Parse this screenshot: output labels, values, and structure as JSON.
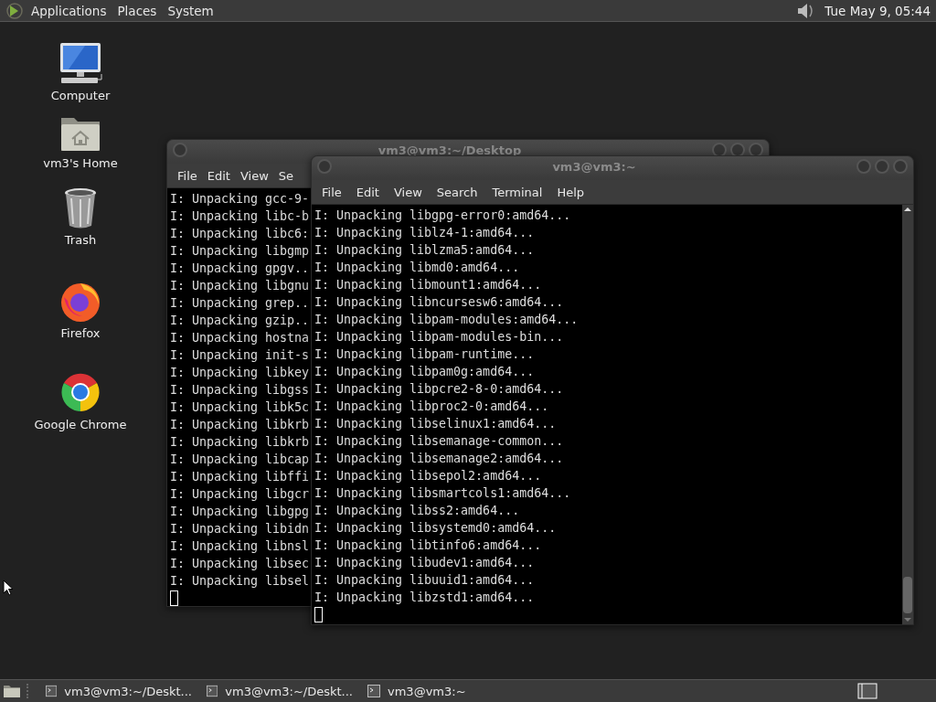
{
  "top_panel": {
    "menus": [
      "Applications",
      "Places",
      "System"
    ],
    "clock": "Tue May  9, 05:44"
  },
  "desktop_icons": [
    {
      "label": "Computer",
      "kind": "computer"
    },
    {
      "label": "vm3's Home",
      "kind": "home"
    },
    {
      "label": "Trash",
      "kind": "trash"
    },
    {
      "label": "Firefox",
      "kind": "firefox"
    },
    {
      "label": "Google Chrome",
      "kind": "chrome"
    }
  ],
  "windows": [
    {
      "title": "vm3@vm3:~/Desktop",
      "menus": [
        "File",
        "Edit",
        "View",
        "Se"
      ],
      "lines": [
        "I: Unpacking gcc-9-",
        "I: Unpacking libc-b",
        "I: Unpacking libc6:",
        "I: Unpacking libgmp",
        "I: Unpacking gpgv..",
        "I: Unpacking libgnu",
        "I: Unpacking grep..",
        "I: Unpacking gzip..",
        "I: Unpacking hostna",
        "I: Unpacking init-s",
        "I: Unpacking libkey",
        "I: Unpacking libgss",
        "I: Unpacking libk5c",
        "I: Unpacking libkrb",
        "I: Unpacking libkrb",
        "I: Unpacking libcap",
        "I: Unpacking libffi",
        "I: Unpacking libgcr",
        "I: Unpacking libgpg",
        "I: Unpacking libidn",
        "I: Unpacking libnsl",
        "I: Unpacking libsec",
        "I: Unpacking libsel"
      ]
    },
    {
      "title": "vm3@vm3:~",
      "menus": [
        "File",
        "Edit",
        "View",
        "Search",
        "Terminal",
        "Help"
      ],
      "lines": [
        "I: Unpacking libgpg-error0:amd64...",
        "I: Unpacking liblz4-1:amd64...",
        "I: Unpacking liblzma5:amd64...",
        "I: Unpacking libmd0:amd64...",
        "I: Unpacking libmount1:amd64...",
        "I: Unpacking libncursesw6:amd64...",
        "I: Unpacking libpam-modules:amd64...",
        "I: Unpacking libpam-modules-bin...",
        "I: Unpacking libpam-runtime...",
        "I: Unpacking libpam0g:amd64...",
        "I: Unpacking libpcre2-8-0:amd64...",
        "I: Unpacking libproc2-0:amd64...",
        "I: Unpacking libselinux1:amd64...",
        "I: Unpacking libsemanage-common...",
        "I: Unpacking libsemanage2:amd64...",
        "I: Unpacking libsepol2:amd64...",
        "I: Unpacking libsmartcols1:amd64...",
        "I: Unpacking libss2:amd64...",
        "I: Unpacking libsystemd0:amd64...",
        "I: Unpacking libtinfo6:amd64...",
        "I: Unpacking libudev1:amd64...",
        "I: Unpacking libuuid1:amd64...",
        "I: Unpacking libzstd1:amd64..."
      ]
    }
  ],
  "taskbar": {
    "tasks": [
      {
        "label": "vm3@vm3:~/Deskt..."
      },
      {
        "label": "vm3@vm3:~/Deskt..."
      },
      {
        "label": "vm3@vm3:~"
      }
    ]
  }
}
